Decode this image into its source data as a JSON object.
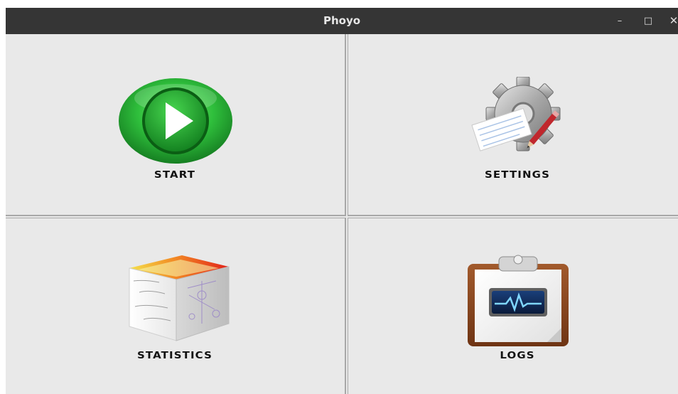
{
  "window": {
    "title": "Phoyo",
    "controls": {
      "minimize": "–",
      "maximize": "□",
      "close": "✕"
    }
  },
  "tiles": [
    {
      "id": "start",
      "label": "START",
      "icon": "play-icon",
      "accent": "#2db83d"
    },
    {
      "id": "settings",
      "label": "SETTINGS",
      "icon": "gear-icon",
      "accent": "#9a9a9a"
    },
    {
      "id": "statistics",
      "label": "STATISTICS",
      "icon": "statistics-cube-icon",
      "accent": "#e23a1c"
    },
    {
      "id": "logs",
      "label": "LOGS",
      "icon": "clipboard-log-icon",
      "accent": "#8b4a24"
    }
  ]
}
